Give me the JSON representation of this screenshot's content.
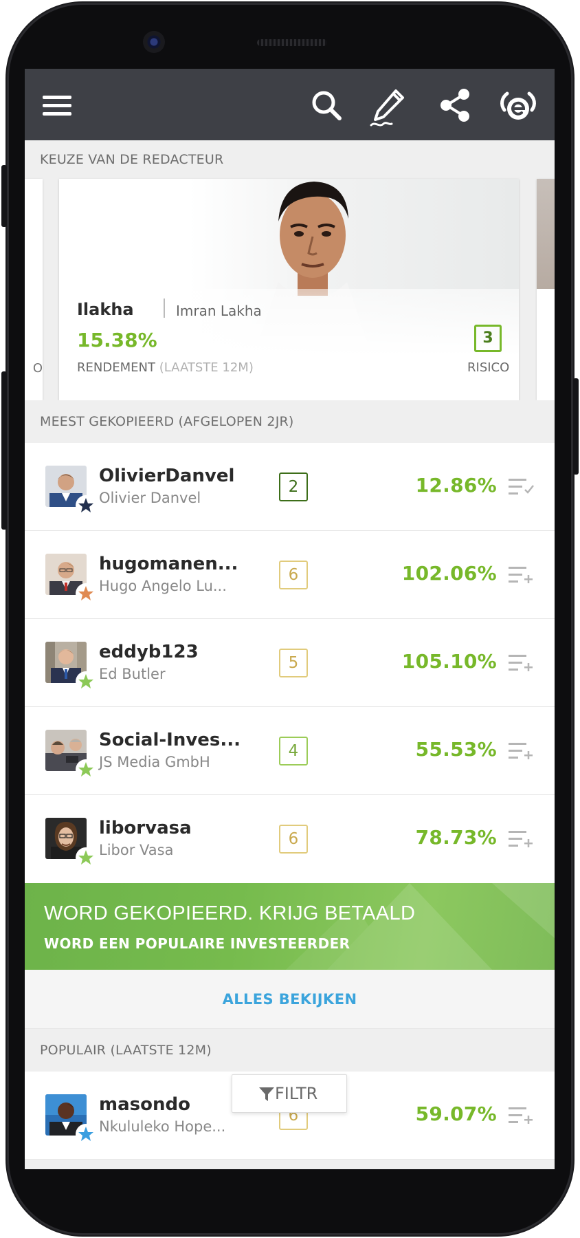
{
  "topbar": {
    "icons": [
      "menu-icon",
      "search-icon",
      "edit-icon",
      "share-icon",
      "etoro-logo-icon"
    ]
  },
  "editors_choice": {
    "header": "KEUZE VAN DE REDACTEUR",
    "left_peek_text": "O",
    "featured": {
      "username": "Ilakha",
      "full_name": "Imran Lakha",
      "return": "15.38%",
      "return_label": "RENDEMENT",
      "return_period": "(LAATSTE 12M)",
      "risk": "3",
      "risk_label": "RISICO"
    }
  },
  "most_copied": {
    "header": "MEEST GEKOPIEERD (AFGELOPEN 2JR)",
    "investors": [
      {
        "username": "OlivierDanvel",
        "name": "Olivier Danvel",
        "risk": "2",
        "gain": "12.86%",
        "star_color": "#22304e",
        "risk_color": "#3d6e19",
        "action_icon": "list-check-icon"
      },
      {
        "username": "hugomanen...",
        "name": "Hugo Angelo Lu...",
        "risk": "6",
        "gain": "102.06%",
        "star_color": "#e08a52",
        "risk_color": "#d9bd6a",
        "action_icon": "list-add-icon"
      },
      {
        "username": "eddyb123",
        "name": "Ed Butler",
        "risk": "5",
        "gain": "105.10%",
        "star_color": "#8cc957",
        "risk_color": "#e1cb7c",
        "action_icon": "list-add-icon"
      },
      {
        "username": "Social-Inves...",
        "name": "JS Media GmbH",
        "risk": "4",
        "gain": "55.53%",
        "star_color": "#8cc957",
        "risk_color": "#9ccc58",
        "action_icon": "list-add-icon"
      },
      {
        "username": "liborvasa",
        "name": "Libor Vasa",
        "risk": "6",
        "gain": "78.73%",
        "star_color": "#8cc957",
        "risk_color": "#d9bd6a",
        "action_icon": "list-add-icon"
      }
    ]
  },
  "promo": {
    "title": "WORD GEKOPIEERD. KRIJG BETAALD",
    "subtitle": "WORD EEN POPULAIRE INVESTEERDER"
  },
  "see_all": "ALLES BEKIJKEN",
  "popular": {
    "header": "POPULAIR (LAATSTE 12M)",
    "investors": [
      {
        "username": "masondo",
        "name": "Nkululeko Hope...",
        "risk": "6",
        "gain": "59.07%",
        "star_color": "#3a9ee0",
        "risk_color": "#d9bd6a",
        "action_icon": "list-add-icon"
      }
    ]
  },
  "filter_button": "FILTR",
  "colors": {
    "topbar": "#3e4046",
    "gain_green": "#77b82a",
    "link_blue": "#3ba4dc",
    "promo_green": "#76bb4d"
  }
}
